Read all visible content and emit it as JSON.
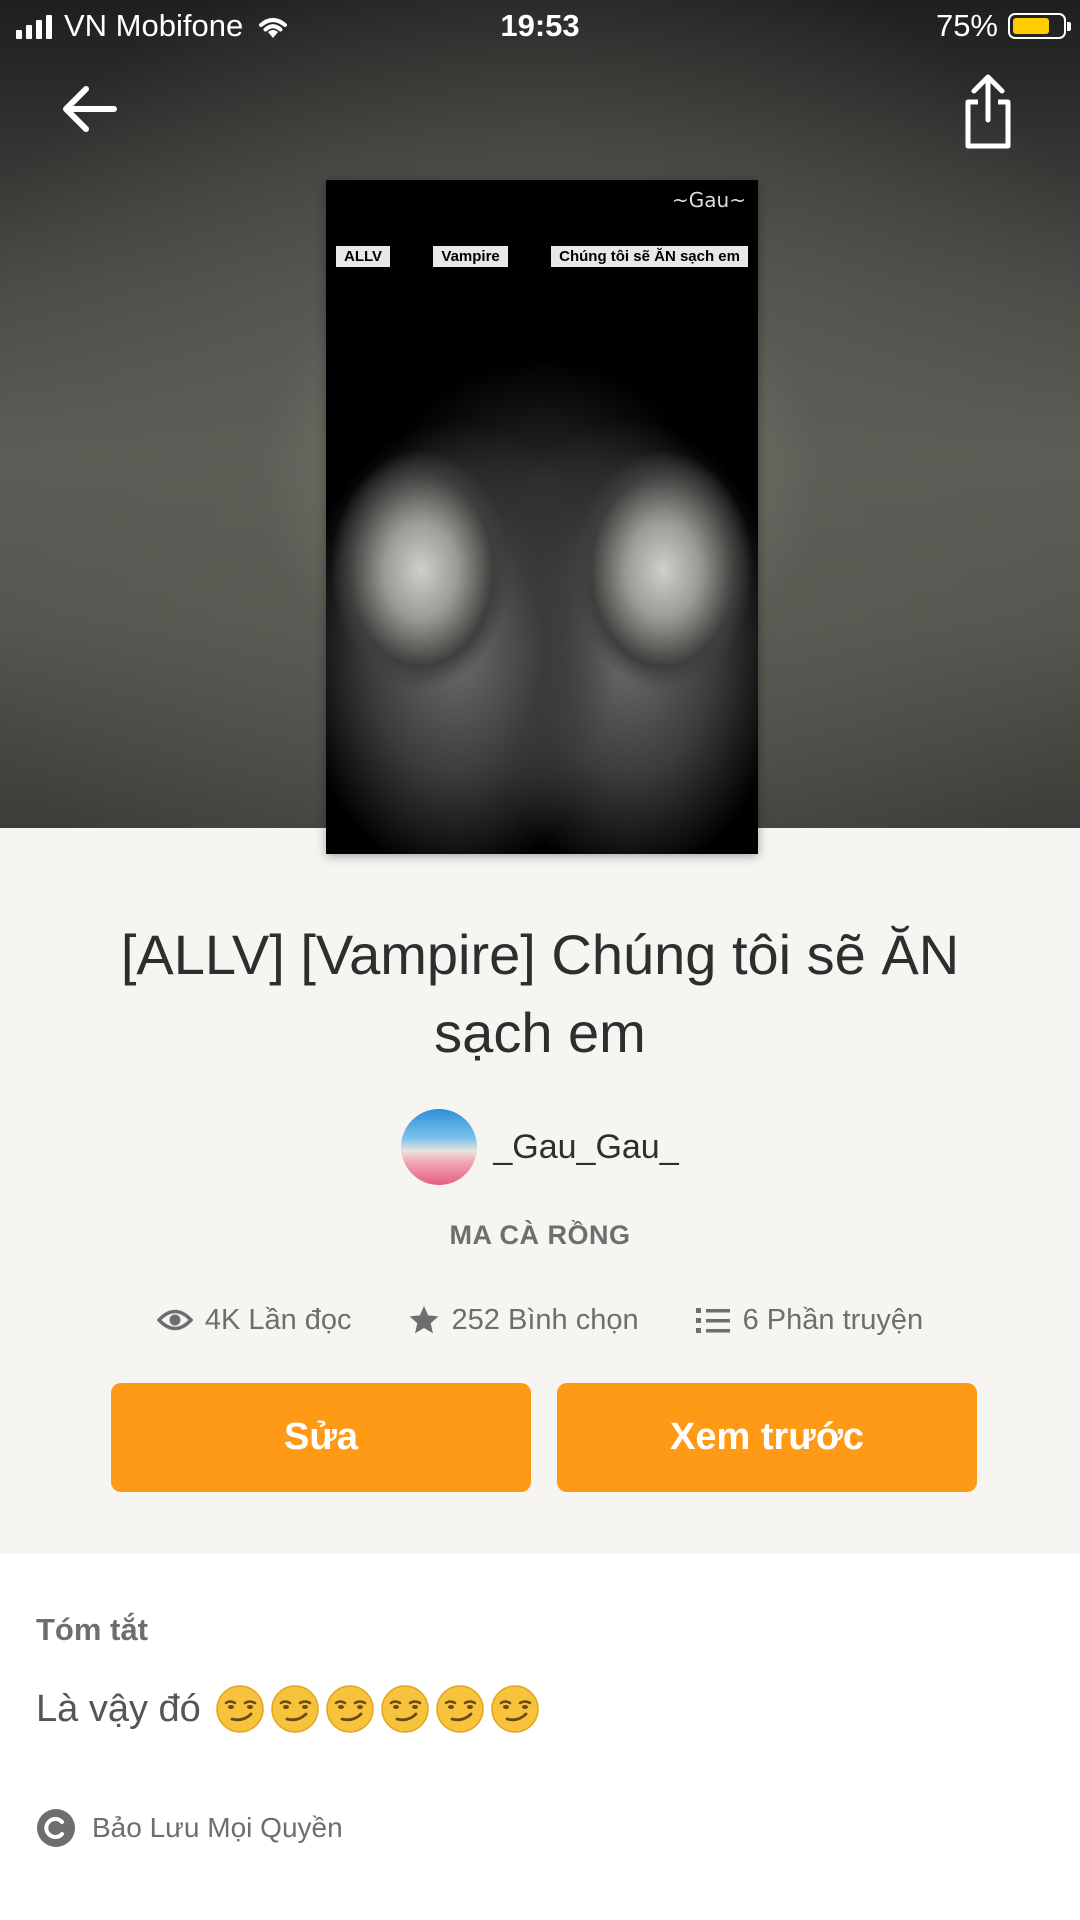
{
  "status_bar": {
    "carrier": "VN Mobifone",
    "time": "19:53",
    "battery_percent_text": "75%",
    "battery_level": 0.75,
    "battery_color": "#ffcc00"
  },
  "header": {
    "back_icon": "arrow-left-icon",
    "share_icon": "share-icon"
  },
  "cover": {
    "signature": "~Gau~",
    "banner_tags": [
      "ALLV",
      "Vampire",
      "Chúng tôi sẽ ĂN sạch em"
    ]
  },
  "story": {
    "title": "[ALLV] [Vampire] Chúng tôi sẽ ĂN sạch em",
    "author": "_Gau_Gau_",
    "genre": "MA CÀ RỒNG",
    "stats": {
      "reads": "4K Lần đọc",
      "votes": "252 Bình chọn",
      "parts": "6 Phần truyện"
    }
  },
  "actions": {
    "edit_label": "Sửa",
    "preview_label": "Xem trước",
    "accent_color": "#ff9a16"
  },
  "summary": {
    "heading": "Tóm tắt",
    "text": "Là vậy đó",
    "emoji_count": 6,
    "emoji_icon": "smirking-face-icon",
    "copyright": "Bảo Lưu Mọi Quyền"
  }
}
